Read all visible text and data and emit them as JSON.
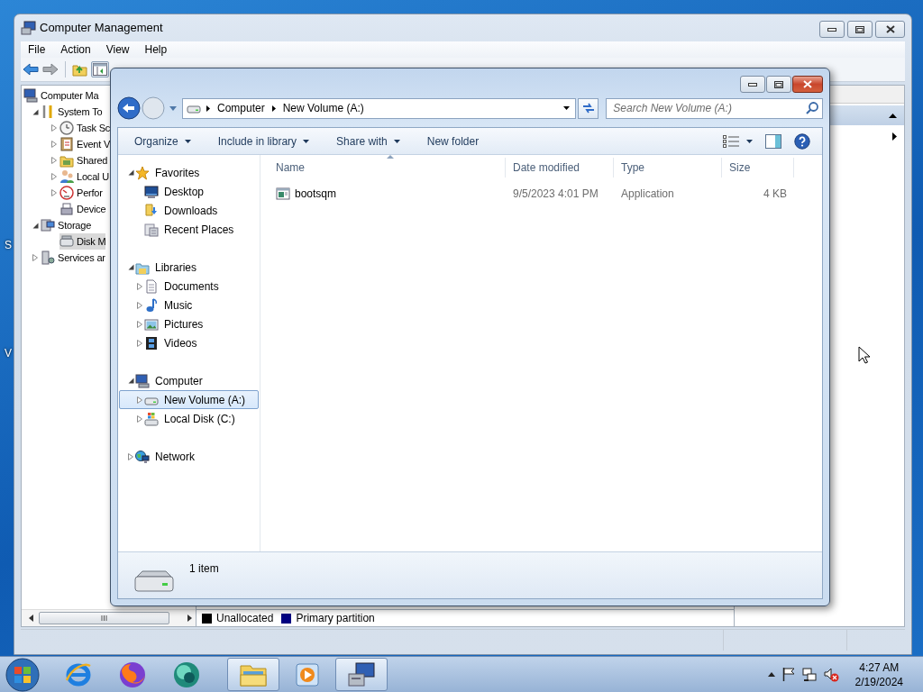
{
  "desktop": {
    "icon_labels": [
      "S",
      "V"
    ]
  },
  "management": {
    "title": "Computer Management",
    "menu": [
      "File",
      "Action",
      "View",
      "Help"
    ],
    "tree": [
      {
        "label": "Computer Ma",
        "selected": false,
        "children": [
          {
            "label": "System To",
            "expanded": true,
            "selected": false,
            "children": [
              {
                "label": "Task Sc",
                "expanded": false,
                "selected": false
              },
              {
                "label": "Event V",
                "expanded": false,
                "selected": false
              },
              {
                "label": "Shared",
                "expanded": false,
                "selected": false
              },
              {
                "label": "Local U",
                "expanded": false,
                "selected": false
              },
              {
                "label": "Perfor",
                "expanded": false,
                "selected": false
              },
              {
                "label": "Device",
                "selected": false
              }
            ]
          },
          {
            "label": "Storage",
            "expanded": true,
            "selected": false,
            "children": [
              {
                "label": "Disk M",
                "selected": true
              }
            ]
          },
          {
            "label": "Services ar",
            "expanded": false,
            "selected": false
          }
        ]
      }
    ],
    "legend": [
      {
        "label": "Unallocated",
        "color": "#000000"
      },
      {
        "label": "Primary partition",
        "color": "#000080"
      }
    ]
  },
  "explorer": {
    "breadcrumb": [
      "Computer",
      "New Volume (A:)"
    ],
    "search": {
      "placeholder": "Search New Volume (A:)"
    },
    "toolbar": [
      {
        "label": "Organize",
        "kind": "menu"
      },
      {
        "label": "Include in library",
        "kind": "menu"
      },
      {
        "label": "Share with",
        "kind": "menu"
      },
      {
        "label": "New folder",
        "kind": "button"
      }
    ],
    "nav": [
      {
        "label": "Favorites",
        "expanded": true,
        "selected": false,
        "children": [
          {
            "label": "Desktop",
            "selected": false
          },
          {
            "label": "Downloads",
            "selected": false
          },
          {
            "label": "Recent Places",
            "selected": false
          }
        ]
      },
      {
        "label": "Libraries",
        "expanded": true,
        "selected": false,
        "children": [
          {
            "label": "Documents",
            "expanded": false,
            "selected": false
          },
          {
            "label": "Music",
            "expanded": false,
            "selected": false
          },
          {
            "label": "Pictures",
            "expanded": false,
            "selected": false
          },
          {
            "label": "Videos",
            "expanded": false,
            "selected": false
          }
        ]
      },
      {
        "label": "Computer",
        "expanded": true,
        "selected": false,
        "children": [
          {
            "label": "New Volume (A:)",
            "expanded": false,
            "selected": true
          },
          {
            "label": "Local Disk (C:)",
            "expanded": false,
            "selected": false
          }
        ]
      },
      {
        "label": "Network",
        "expanded": false,
        "selected": false
      }
    ],
    "columns": [
      {
        "label": "Name",
        "sorted": true
      },
      {
        "label": "Date modified",
        "sorted": false
      },
      {
        "label": "Type",
        "sorted": false
      },
      {
        "label": "Size",
        "sorted": false
      }
    ],
    "files": [
      {
        "name": "bootsqm",
        "date_modified": "9/5/2023 4:01 PM",
        "type": "Application",
        "size": "4 KB",
        "selected": false
      }
    ],
    "item_count": "1 item"
  },
  "taskbar": {
    "apps": [
      {
        "active": false
      },
      {
        "active": false
      },
      {
        "active": false
      },
      {
        "active": true
      },
      {
        "active": false
      },
      {
        "active": true
      }
    ],
    "time": "4:27 AM",
    "date": "2/19/2024"
  }
}
